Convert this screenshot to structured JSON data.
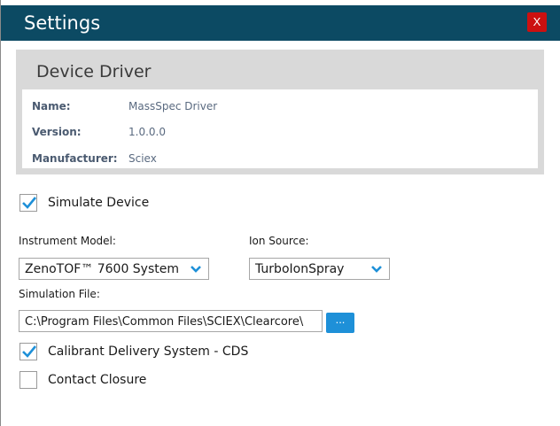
{
  "window": {
    "title": "Settings",
    "close_label": "X"
  },
  "device_driver": {
    "heading": "Device Driver",
    "name_label": "Name:",
    "name_value": "MassSpec Driver",
    "version_label": "Version:",
    "version_value": "1.0.0.0",
    "manufacturer_label": "Manufacturer:",
    "manufacturer_value": "Sciex"
  },
  "simulate_device": {
    "label": "Simulate Device",
    "checked": true
  },
  "instrument_model": {
    "label": "Instrument Model:",
    "selected": "ZenoTOF™ 7600 System"
  },
  "ion_source": {
    "label": "Ion Source:",
    "selected": "TurboIonSpray"
  },
  "simulation_file": {
    "label": "Simulation File:",
    "value": "C:\\Program Files\\Common Files\\SCIEX\\Clearcore\\",
    "browse_label": "..."
  },
  "cds": {
    "label": "Calibrant Delivery System - CDS",
    "checked": true
  },
  "contact_closure": {
    "label": "Contact Closure",
    "checked": false
  },
  "colors": {
    "titlebar": "#0c4a63",
    "accent": "#1e90d8",
    "close": "#cc1010"
  },
  "icons": {
    "check": "checkmark-icon",
    "dropdown": "chevron-down-icon"
  }
}
